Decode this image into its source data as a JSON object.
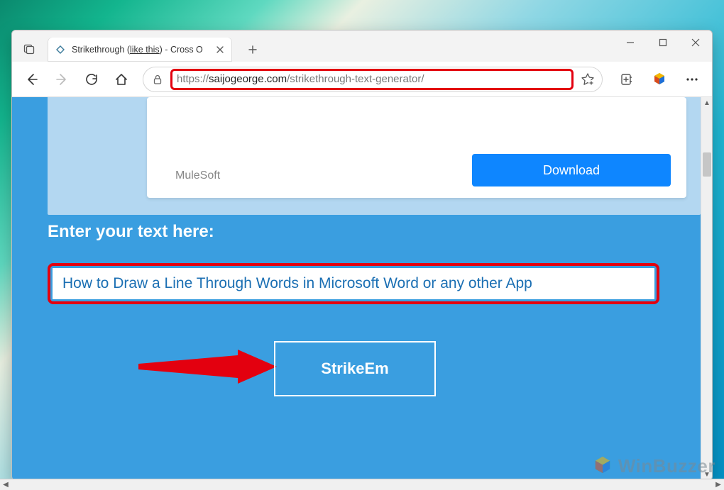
{
  "window": {
    "tab_title_prefix": "Strikethrough (",
    "tab_title_underlined": "like this",
    "tab_title_suffix": ") - Cross O"
  },
  "address": {
    "prefix": "https://",
    "host": "saijogeorge.com",
    "path": "/strikethrough-text-generator/"
  },
  "ad": {
    "brand": "MuleSoft",
    "cta": "Download"
  },
  "page": {
    "prompt": "Enter your text here:",
    "input_value": "How to Draw a Line Through Words in Microsoft Word or any other App",
    "button": "StrikeEm"
  },
  "watermark": {
    "text": "WinBuzzer"
  }
}
